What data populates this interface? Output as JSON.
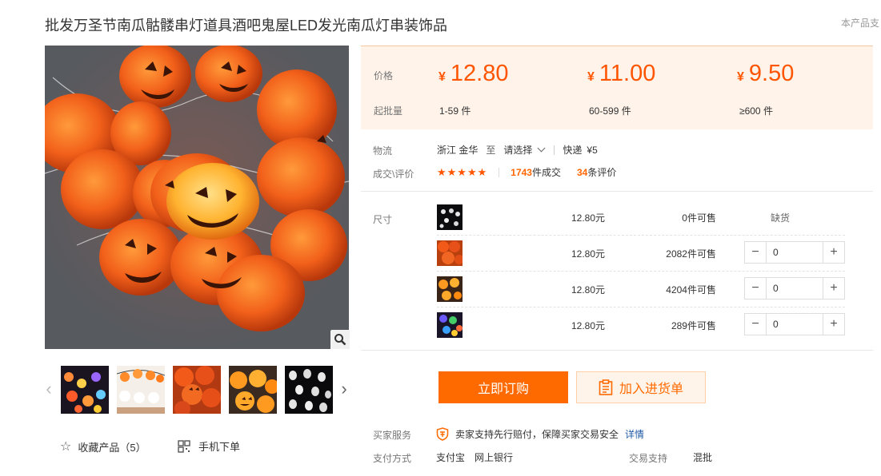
{
  "header": {
    "title": "批发万圣节南瓜骷髅串灯道具酒吧鬼屋LED发光南瓜灯串装饰品",
    "right_hint": "本产品支"
  },
  "gallery": {
    "thumbnail_count": 5
  },
  "actions": {
    "collect_label": "收藏产品（5）",
    "mobile_label": "手机下单"
  },
  "price": {
    "price_label": "价格",
    "moq_label": "起批量",
    "currency": "¥",
    "tiers": [
      {
        "price": "12.80",
        "range": "1-59",
        "unit": "件"
      },
      {
        "price": "11.00",
        "range": "60-599",
        "unit": "件"
      },
      {
        "price": "9.50",
        "range": "≥600",
        "unit": "件"
      }
    ]
  },
  "logistics": {
    "label": "物流",
    "origin": "浙江 金华",
    "to": "至",
    "dest": "请选择",
    "express": "快递",
    "fee": "¥5"
  },
  "deals": {
    "label": "成交\\评价",
    "stars": "★★★★★",
    "rating": 5,
    "sold_count": "1743",
    "sold_suffix": "件成交",
    "review_count": "34",
    "review_suffix": "条评价"
  },
  "sku": {
    "label": "尺寸",
    "rows": [
      {
        "price": "12.80元",
        "stock_num": "0",
        "stock_suffix": "件可售",
        "status": "缺货",
        "qty": null
      },
      {
        "price": "12.80元",
        "stock_num": "2082",
        "stock_suffix": "件可售",
        "status": "",
        "qty": "0"
      },
      {
        "price": "12.80元",
        "stock_num": "4204",
        "stock_suffix": "件可售",
        "status": "",
        "qty": "0"
      },
      {
        "price": "12.80元",
        "stock_num": "289",
        "stock_suffix": "件可售",
        "status": "",
        "qty": "0"
      }
    ]
  },
  "buttons": {
    "buy": "立即订购",
    "cart": "加入进货单"
  },
  "service": {
    "buyer_label": "买家服务",
    "buyer_text": "卖家支持先行赔付，保障买家交易安全",
    "detail_link": "详情",
    "pay_label": "支付方式",
    "pay_methods": [
      "支付宝",
      "网上银行"
    ],
    "trade_label": "交易支持",
    "trade_value": "混批"
  },
  "colors": {
    "accent": "#ff6a00",
    "price": "#ff5500",
    "price_bg": "#fff3ea",
    "link": "#1f5aa6"
  }
}
